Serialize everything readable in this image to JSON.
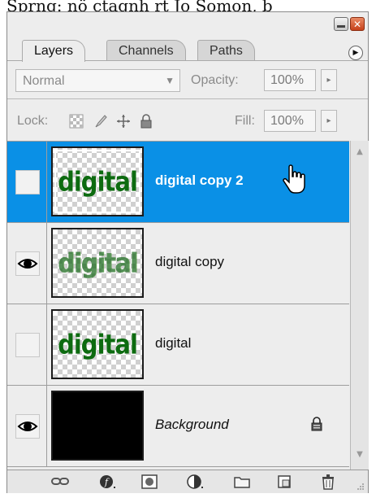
{
  "caption": {
    "text": "Sprng: nö ctagnh rt Jo Somon, b"
  },
  "window": {
    "minimize_label": "",
    "close_label": "✕"
  },
  "tabs": [
    {
      "label": "Layers",
      "active": true
    },
    {
      "label": "Channels",
      "active": false
    },
    {
      "label": "Paths",
      "active": false
    }
  ],
  "options": {
    "blend_mode": "Normal",
    "opacity_label": "Opacity:",
    "opacity_value": "100%",
    "lock_label": "Lock:",
    "fill_label": "Fill:",
    "fill_value": "100%",
    "stepper_glyph": "▸"
  },
  "layers": [
    {
      "name": "digital copy 2",
      "visible": false,
      "selected": true,
      "thumb_text": "digital",
      "thumb": "checker"
    },
    {
      "name": "digital copy",
      "visible": true,
      "selected": false,
      "thumb_text": "digital",
      "thumb": "checker-fuzzy"
    },
    {
      "name": "digital",
      "visible": false,
      "selected": false,
      "thumb_text": "digital",
      "thumb": "checker"
    },
    {
      "name": "Background",
      "visible": true,
      "selected": false,
      "thumb_text": "",
      "thumb": "black",
      "locked": true,
      "italic": true
    }
  ],
  "footer_icons": [
    "link-layers-icon",
    "layer-style-icon",
    "layer-mask-icon",
    "adjustment-layer-icon",
    "new-group-icon",
    "new-layer-icon",
    "delete-layer-icon"
  ],
  "colors": {
    "selection": "#0a90e6",
    "thumb_text": "#0d6b10"
  }
}
